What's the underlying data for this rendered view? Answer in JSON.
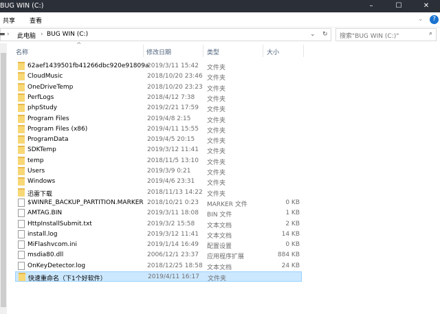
{
  "window": {
    "title": "BUG WIN (C:)",
    "minimize": "–",
    "maximize": "☐",
    "close": "✕"
  },
  "ribbon": {
    "tabs": [
      "共享",
      "查看"
    ],
    "expand": "⌄",
    "help": "?"
  },
  "address": {
    "crumbs": [
      "此电脑",
      "BUG WIN (C:)"
    ],
    "sep": "›",
    "dropdown": "⌄",
    "refresh": "↻"
  },
  "search": {
    "placeholder": "搜索\"BUG WIN (C:)\"",
    "icon": "⌕"
  },
  "columns": {
    "name": "名称",
    "date": "修改日期",
    "type": "类型",
    "size": "大小",
    "sort_arrow": "^"
  },
  "files": [
    {
      "name": "62aef1439501fb41266dbc920e91809a",
      "date": "2019/3/11 15:42",
      "type": "文件夹",
      "size": "",
      "kind": "folder"
    },
    {
      "name": "CloudMusic",
      "date": "2018/10/20 23:46",
      "type": "文件夹",
      "size": "",
      "kind": "folder"
    },
    {
      "name": "OneDriveTemp",
      "date": "2018/10/20 23:23",
      "type": "文件夹",
      "size": "",
      "kind": "folder"
    },
    {
      "name": "PerfLogs",
      "date": "2018/4/12 7:38",
      "type": "文件夹",
      "size": "",
      "kind": "folder"
    },
    {
      "name": "phpStudy",
      "date": "2019/2/21 17:59",
      "type": "文件夹",
      "size": "",
      "kind": "folder"
    },
    {
      "name": "Program Files",
      "date": "2019/4/8 2:15",
      "type": "文件夹",
      "size": "",
      "kind": "folder"
    },
    {
      "name": "Program Files (x86)",
      "date": "2019/4/11 15:55",
      "type": "文件夹",
      "size": "",
      "kind": "folder"
    },
    {
      "name": "ProgramData",
      "date": "2019/4/5 20:15",
      "type": "文件夹",
      "size": "",
      "kind": "folder"
    },
    {
      "name": "SDKTemp",
      "date": "2019/3/12 11:41",
      "type": "文件夹",
      "size": "",
      "kind": "folder"
    },
    {
      "name": "temp",
      "date": "2018/11/5 13:10",
      "type": "文件夹",
      "size": "",
      "kind": "folder"
    },
    {
      "name": "Users",
      "date": "2019/3/9 0:21",
      "type": "文件夹",
      "size": "",
      "kind": "folder"
    },
    {
      "name": "Windows",
      "date": "2019/4/6 23:31",
      "type": "文件夹",
      "size": "",
      "kind": "folder"
    },
    {
      "name": "迅雷下载",
      "date": "2018/11/13 14:22",
      "type": "文件夹",
      "size": "",
      "kind": "folder"
    },
    {
      "name": "$WINRE_BACKUP_PARTITION.MARKER",
      "date": "2018/10/21 0:23",
      "type": "MARKER 文件",
      "size": "0 KB",
      "kind": "file"
    },
    {
      "name": "AMTAG.BIN",
      "date": "2019/3/11 18:08",
      "type": "BIN 文件",
      "size": "1 KB",
      "kind": "file"
    },
    {
      "name": "HttpInstallSubmit.txt",
      "date": "2019/3/2 15:58",
      "type": "文本文档",
      "size": "2 KB",
      "kind": "file"
    },
    {
      "name": "install.log",
      "date": "2019/3/12 11:41",
      "type": "文本文档",
      "size": "14 KB",
      "kind": "file"
    },
    {
      "name": "MiFlashvcom.ini",
      "date": "2019/1/14 16:49",
      "type": "配置设置",
      "size": "0 KB",
      "kind": "file"
    },
    {
      "name": "msdia80.dll",
      "date": "2006/12/1 23:37",
      "type": "应用程序扩展",
      "size": "884 KB",
      "kind": "file"
    },
    {
      "name": "OnKeyDetector.log",
      "date": "2018/12/25 18:58",
      "type": "文本文档",
      "size": "24 KB",
      "kind": "file"
    },
    {
      "name": "快速重命名（下1个好软件）",
      "date": "2019/4/11 16:17",
      "type": "文件夹",
      "size": "",
      "kind": "folder",
      "selected": true
    }
  ]
}
